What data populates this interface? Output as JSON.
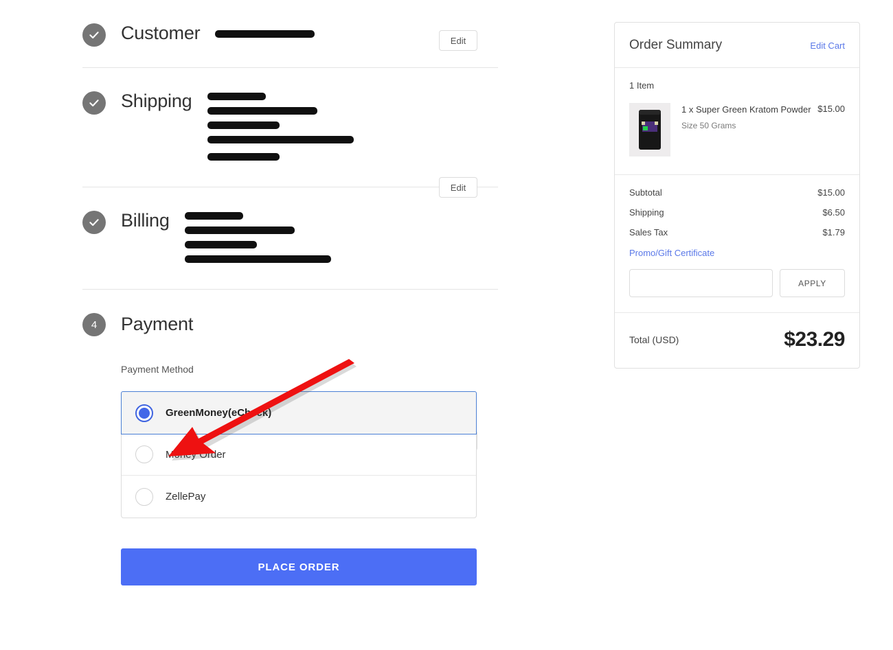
{
  "steps": [
    {
      "key": "customer",
      "title": "Customer",
      "status": "complete",
      "badge_icon": "check-icon",
      "edit_label": "Edit",
      "redacted_lines": [
        145
      ]
    },
    {
      "key": "shipping",
      "title": "Shipping",
      "status": "complete",
      "badge_icon": "check-icon",
      "edit_label": "Edit",
      "redacted_lines": [
        85,
        160,
        105,
        213,
        105
      ]
    },
    {
      "key": "billing",
      "title": "Billing",
      "status": "complete",
      "badge_icon": "check-icon",
      "edit_label": "Edit",
      "redacted_lines": [
        85,
        160,
        105,
        213
      ]
    }
  ],
  "payment": {
    "step_number": "4",
    "title": "Payment",
    "method_label": "Payment Method",
    "methods": [
      {
        "label": "GreenMoney(eCheck)",
        "selected": true
      },
      {
        "label": "Money Order",
        "selected": false
      },
      {
        "label": "ZellePay",
        "selected": false
      }
    ],
    "place_order_label": "PLACE ORDER"
  },
  "summary": {
    "title": "Order Summary",
    "edit_cart_label": "Edit Cart",
    "item_count_label": "1 Item",
    "items": [
      {
        "name": "1 x Super Green Kratom Powder",
        "variant": "Size 50 Grams",
        "price": "$15.00",
        "thumb_icon": "product-pouch-image"
      }
    ],
    "totals": [
      {
        "label": "Subtotal",
        "value": "$15.00"
      },
      {
        "label": "Shipping",
        "value": "$6.50"
      },
      {
        "label": "Sales Tax",
        "value": "$1.79"
      }
    ],
    "promo_link_label": "Promo/Gift Certificate",
    "promo_input_value": "",
    "apply_label": "APPLY",
    "grand_total_label": "Total (USD)",
    "grand_total_value": "$23.29"
  },
  "annotation": {
    "type": "arrow",
    "color": "#ee1111",
    "points_to": "greenmoney-echeck-radio"
  },
  "colors": {
    "primary_button": "#4c6ef5",
    "link": "#5a78e8",
    "selected_border": "#4a7fd4",
    "radio_selected": "#4367e8",
    "badge": "#757575",
    "annotation_red": "#ee1111"
  }
}
